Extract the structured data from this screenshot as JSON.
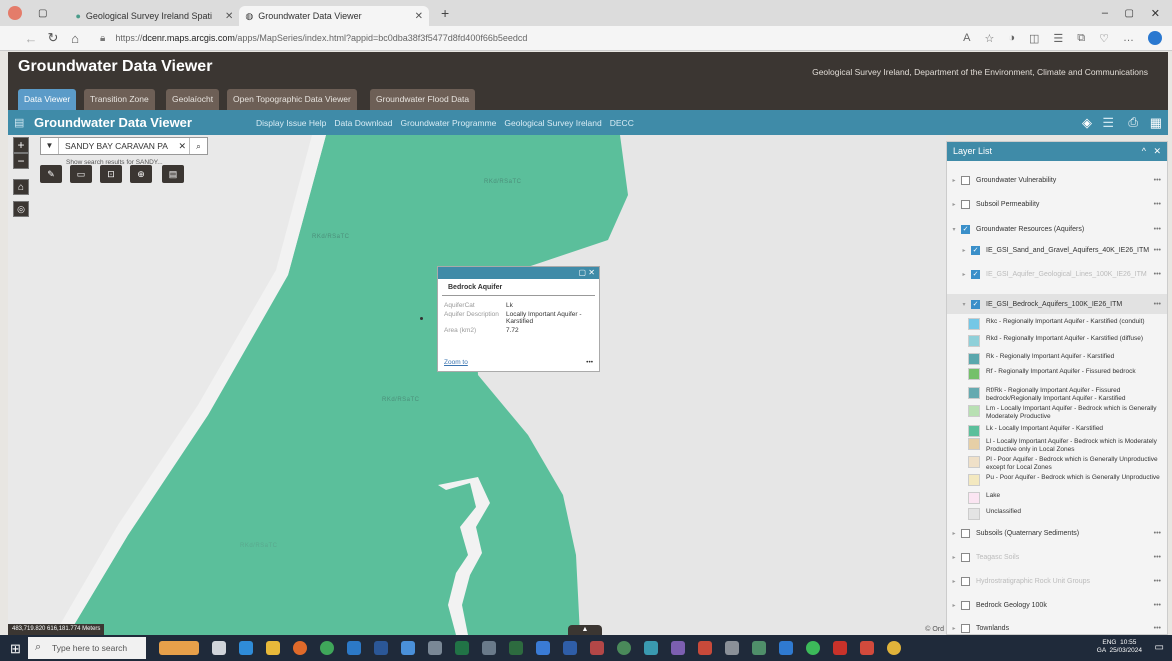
{
  "browser": {
    "tabs": [
      {
        "label": "Geological Survey Ireland Spati"
      },
      {
        "label": "Groundwater Data Viewer"
      }
    ],
    "url_prefix": "https://",
    "url_host": "dcenr.maps.arcgis.com",
    "url_path": "/apps/MapSeries/index.html?appid=bc0dba38f3f5477d8fd400f66b5eedcd"
  },
  "app": {
    "title": "Groundwater Data Viewer",
    "subtitle": "Geological Survey Ireland, Department of the Environment, Climate and Communications",
    "tabs": [
      "Data Viewer",
      "Transition Zone",
      "Geolaíocht",
      "Open Topographic Data Viewer",
      "Groundwater Flood Data"
    ]
  },
  "mapbar": {
    "title": "Groundwater Data Viewer",
    "links": [
      "Display Issue Help",
      "Data Download",
      "Groundwater Programme",
      "Geological Survey Ireland",
      "DECC"
    ]
  },
  "map": {
    "search_value": "SANDY BAY CARAVAN PA",
    "search_hint": "Show search results for SANDY...",
    "labels": [
      "RKd/RSaTC",
      "RKd/RSaTC",
      "RKd/RSaTC",
      "RKd/RSaTC"
    ],
    "coords": "483,719.820 616,181.774 Meters",
    "attribution": "© Ord"
  },
  "popup": {
    "title": "Bedrock Aquifer",
    "rows": [
      {
        "key": "AquiferCat",
        "value": "Lk"
      },
      {
        "key": "Aquifer Description",
        "value": "Locally Important Aquifer - Karstified"
      },
      {
        "key": "Area (km2)",
        "value": "7.72"
      }
    ],
    "zoom_label": "Zoom to",
    "more": "•••"
  },
  "layer_list": {
    "title": "Layer List",
    "layers": [
      {
        "label": "Groundwater Vulnerability",
        "checked": false
      },
      {
        "label": "Subsoil Permeability",
        "checked": false
      },
      {
        "label": "Groundwater Resources (Aquifers)",
        "checked": true
      },
      {
        "label": "IE_GSI_Sand_and_Gravel_Aquifers_40K_IE26_ITM",
        "checked": true
      },
      {
        "label": "IE_GSI_Aquifer_Geological_Lines_100K_IE26_ITM",
        "checked": true
      },
      {
        "label": "IE_GSI_Bedrock_Aquifers_100K_IE26_ITM",
        "checked": true
      }
    ],
    "legend": [
      {
        "label": "Rkc - Regionally Important Aquifer - Karstified (conduit)",
        "color": "#74c7e6"
      },
      {
        "label": "Rkd - Regionally Important Aquifer - Karstified (diffuse)",
        "color": "#8fd0d9"
      },
      {
        "label": "Rk - Regionally Important Aquifer - Karstified",
        "color": "#5aa7ad"
      },
      {
        "label": "Rf - Regionally Important Aquifer - Fissured bedrock",
        "color": "#74c06a"
      },
      {
        "label": "Rf/Rk - Regionally Important Aquifer - Fissured bedrock/Regionally Important Aquifer - Karstified",
        "color": "#66aab0"
      },
      {
        "label": "Lm - Locally Important Aquifer - Bedrock which is Generally Moderately Productive",
        "color": "#b8e0b3"
      },
      {
        "label": "Lk - Locally Important Aquifer - Karstified",
        "color": "#5bbf9b"
      },
      {
        "label": "Ll - Locally Important Aquifer - Bedrock which is Moderately Productive only in Local Zones",
        "color": "#e6cfa6"
      },
      {
        "label": "Pl - Poor Aquifer - Bedrock which is Generally Unproductive except for Local Zones",
        "color": "#efe0c8"
      },
      {
        "label": "Pu - Poor Aquifer - Bedrock which is Generally Unproductive",
        "color": "#f3e8bf"
      },
      {
        "label": "Lake",
        "color": "#fbe5f2"
      },
      {
        "label": "Unclassified",
        "color": "#e4e4e4"
      }
    ],
    "layers_after": [
      {
        "label": "Subsoils (Quaternary Sediments)",
        "checked": false
      },
      {
        "label": "Teagasc Soils",
        "checked": false
      },
      {
        "label": "Hydrostratigraphic Rock Unit Groups",
        "checked": false
      },
      {
        "label": "Bedrock Geology 100k",
        "checked": false
      },
      {
        "label": "Townlands",
        "checked": false
      }
    ],
    "more": "•••"
  },
  "taskbar": {
    "search_placeholder": "Type here to search",
    "lang": "ENG",
    "lang2": "GA",
    "time": "10:55",
    "date": "25/03/2024"
  }
}
